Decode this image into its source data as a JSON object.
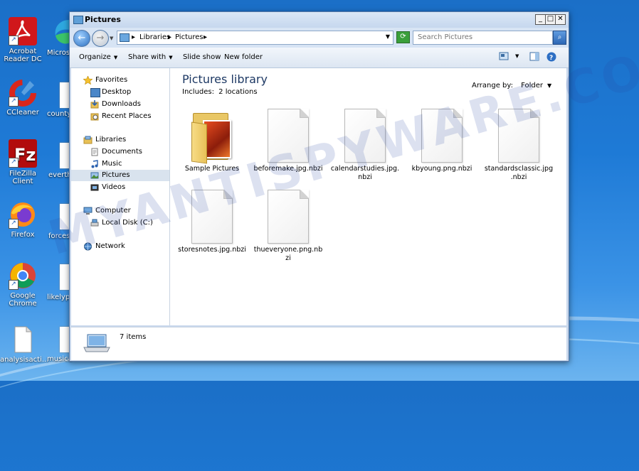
{
  "watermark": "MYANTISPYWARE.COM",
  "desktop": {
    "icons": [
      {
        "label": "Acrobat Reader DC"
      },
      {
        "label": "CCleaner"
      },
      {
        "label": "FileZilla Client"
      },
      {
        "label": "Firefox"
      },
      {
        "label": "Google Chrome"
      },
      {
        "label": "analysisacti..."
      }
    ],
    "peek_labels": [
      "Microso",
      "countys",
      "everth",
      "forcest",
      "likelypre",
      "musica"
    ]
  },
  "window": {
    "title": "Pictures",
    "controls": {
      "minimize": "_",
      "maximize": "□",
      "close": "✕"
    },
    "breadcrumb": [
      "Libraries",
      "Pictures"
    ],
    "search_placeholder": "Search Pictures",
    "toolbar": {
      "organize": "Organize",
      "share_with": "Share with",
      "slide_show": "Slide show",
      "new_folder": "New folder"
    },
    "nav": {
      "favorites": "Favorites",
      "desktop": "Desktop",
      "downloads": "Downloads",
      "recent_places": "Recent Places",
      "libraries": "Libraries",
      "documents": "Documents",
      "music": "Music",
      "pictures": "Pictures",
      "videos": "Videos",
      "computer": "Computer",
      "local_disk": "Local Disk (C:)",
      "network": "Network"
    },
    "library": {
      "title": "Pictures library",
      "includes_label": "Includes:",
      "includes_link": "2 locations",
      "arrange_label": "Arrange by:",
      "arrange_value": "Folder"
    },
    "files": [
      {
        "name": "Sample Pictures",
        "type": "folder"
      },
      {
        "name": "beforemake.jpg.nbzi",
        "type": "file"
      },
      {
        "name": "calendarstudies.jpg.nbzi",
        "type": "file"
      },
      {
        "name": "kbyoung.png.nbzi",
        "type": "file"
      },
      {
        "name": "standardsclassic.jpg.nbzi",
        "type": "file"
      },
      {
        "name": "storesnotes.jpg.nbzi",
        "type": "file"
      },
      {
        "name": "thueveryone.png.nbzi",
        "type": "file"
      }
    ],
    "status": {
      "item_count": "7 items"
    }
  }
}
